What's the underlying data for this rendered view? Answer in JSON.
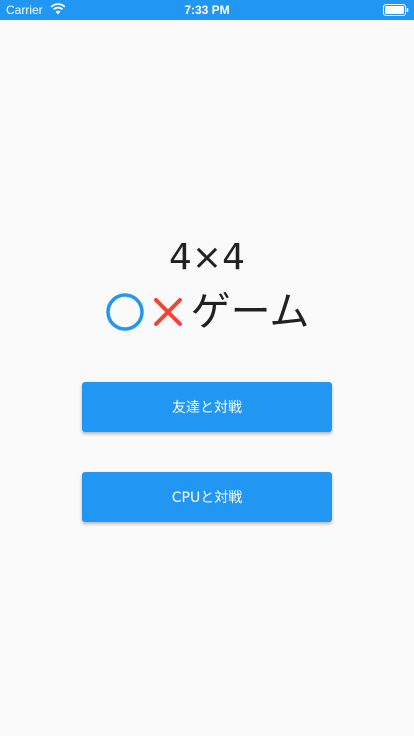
{
  "status_bar": {
    "carrier": "Carrier",
    "time": "7:33 PM",
    "background_color": "#2196f3",
    "icons": [
      "wifi-icon",
      "battery-icon"
    ]
  },
  "title": {
    "line1": "4×4",
    "line2_text": "ゲーム",
    "o_mark_color": "#2196f3",
    "x_mark_color": "#f44336",
    "icons": [
      "circle-mark-icon",
      "cross-mark-icon"
    ]
  },
  "buttons": {
    "vs_friend": "友達と対戦",
    "vs_cpu": "CPUと対戦",
    "color": "#2196f3"
  }
}
